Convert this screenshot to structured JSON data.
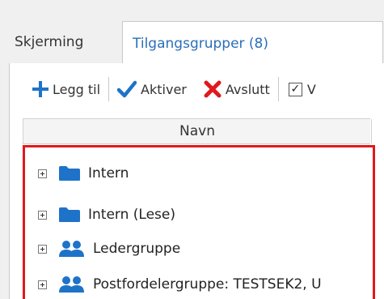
{
  "tabs": [
    {
      "label": "Skjerming",
      "active": false
    },
    {
      "label": "Tilgangsgrupper (8)",
      "active": true
    }
  ],
  "toolbar": {
    "add_label": "Legg til",
    "activate_label": "Aktiver",
    "end_label": "Avslutt",
    "checkbox_label": "V",
    "checkbox_checked": true
  },
  "grid": {
    "column_header": "Navn",
    "rows": [
      {
        "label": "Intern",
        "icon": "folder-icon"
      },
      {
        "label": "Intern (Lese)",
        "icon": "folder-icon"
      },
      {
        "label": "Ledergruppe",
        "icon": "user-group-icon"
      },
      {
        "label": "Postfordelergruppe: TESTSEK2, U",
        "icon": "user-group-icon"
      }
    ]
  },
  "colors": {
    "accent_blue": "#2a6fb8",
    "icon_blue": "#1e73c8",
    "delete_red": "#e0191d",
    "selection_border": "#e0191d"
  }
}
